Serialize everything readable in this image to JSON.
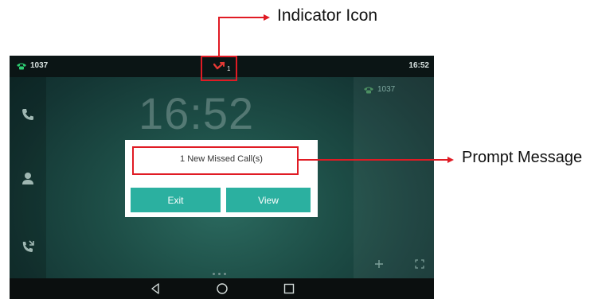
{
  "annotations": {
    "indicator_label": "Indicator Icon",
    "prompt_label": "Prompt Message",
    "color": "#e01b24"
  },
  "status_bar": {
    "account": "1037",
    "time": "16:52",
    "missed_call_count": "1"
  },
  "right_panel": {
    "account": "1037"
  },
  "clock": "16:52",
  "dialog": {
    "message": "1 New Missed Call(s)",
    "exit_label": "Exit",
    "view_label": "View"
  },
  "colors": {
    "button": "#2bb0a0",
    "phone_icon_green": "#2ecc71",
    "missed_call_red": "#e53935"
  },
  "icons": {
    "left_sidebar": [
      "phone-icon",
      "contacts-icon",
      "call-log-icon"
    ],
    "right_panel_bottom": [
      "add-icon",
      "expand-icon"
    ],
    "navigation": [
      "back-icon",
      "home-icon",
      "recent-apps-icon"
    ]
  }
}
